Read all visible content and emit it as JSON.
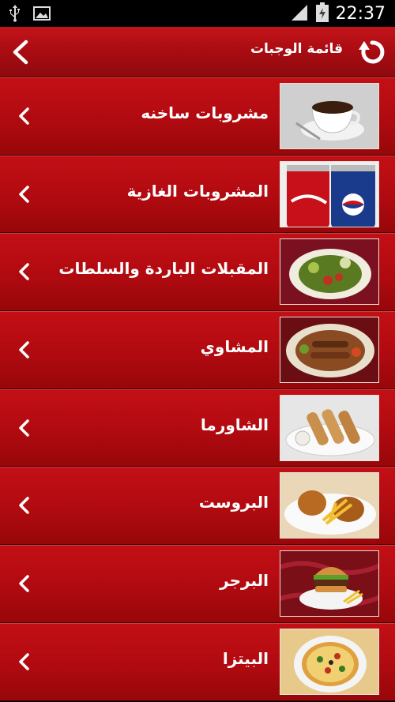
{
  "status_bar": {
    "time": "22:37",
    "icons": [
      "usb-icon",
      "image-icon",
      "signal-icon",
      "battery-icon"
    ]
  },
  "action_bar": {
    "title": "قائمة الوجبات",
    "back_icon": "chevron-left-icon",
    "refresh_icon": "refresh-icon",
    "background_color": "#b00a10"
  },
  "menu": {
    "items": [
      {
        "label": "مشروبات ساخنه",
        "thumb": "coffee-cup"
      },
      {
        "label": "المشروبات الغازية",
        "thumb": "soda-cans"
      },
      {
        "label": "المقبلات الباردة والسلطات",
        "thumb": "salad-plate"
      },
      {
        "label": "المشاوي",
        "thumb": "grill-platter"
      },
      {
        "label": "الشاورما",
        "thumb": "shawarma-rolls"
      },
      {
        "label": "البروست",
        "thumb": "fried-chicken"
      },
      {
        "label": "البرجر",
        "thumb": "burger"
      },
      {
        "label": "البيتزا",
        "thumb": "pizza"
      }
    ]
  }
}
